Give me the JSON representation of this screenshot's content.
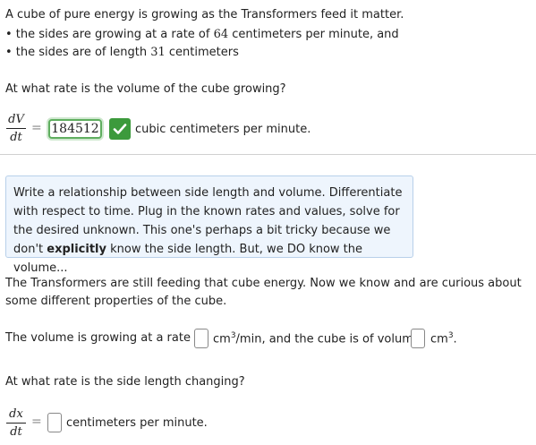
{
  "problem": {
    "intro": "A cube of pure energy is growing as the Transformers feed it matter.",
    "bullet1_pre": "• the sides are growing at a rate of ",
    "bullet1_num": "64",
    "bullet1_post": " centimeters per minute, and",
    "bullet2_pre": "• the sides are of length ",
    "bullet2_num": "31",
    "bullet2_post": " centimeters",
    "question1": "At what rate is the volume of the cube growing?"
  },
  "part1": {
    "frac_top": "dV",
    "frac_bottom": "dt",
    "equals": "=",
    "answer": "184512",
    "unit": "cubic centimeters per minute."
  },
  "hint": {
    "text_before_bold": "Write a relationship between side length and volume. Differentiate with respect to time. Plug in the known rates and values, solve for the desired unknown. This one's perhaps a bit tricky because we don't ",
    "bold": "explicitly",
    "text_after_bold": " know the side length. But, we DO know the volume..."
  },
  "part2": {
    "intro": "The Transformers are still feeding that cube energy. Now we know and are curious about some different properties of the cube.",
    "sentence_pre": "The volume is growing at a rate of",
    "unit_rate": "cm",
    "unit_rate_exp": "3",
    "unit_rate_suffix": "/min, and the cube is of volume",
    "unit_volume": "cm",
    "unit_volume_exp": "3",
    "unit_volume_suffix": ".",
    "volume_rate_value": "",
    "volume_value": "",
    "question2": "At what rate is the side length changing?",
    "frac_top": "dx",
    "frac_bottom": "dt",
    "equals": "=",
    "side_rate_value": "",
    "unit": "centimeters per minute."
  },
  "colors": {
    "correct_green": "#3c9a3c",
    "hint_background": "#eef5fd",
    "hint_border": "#b8d0ea"
  },
  "icons": {
    "correct": "checkmark-icon"
  }
}
